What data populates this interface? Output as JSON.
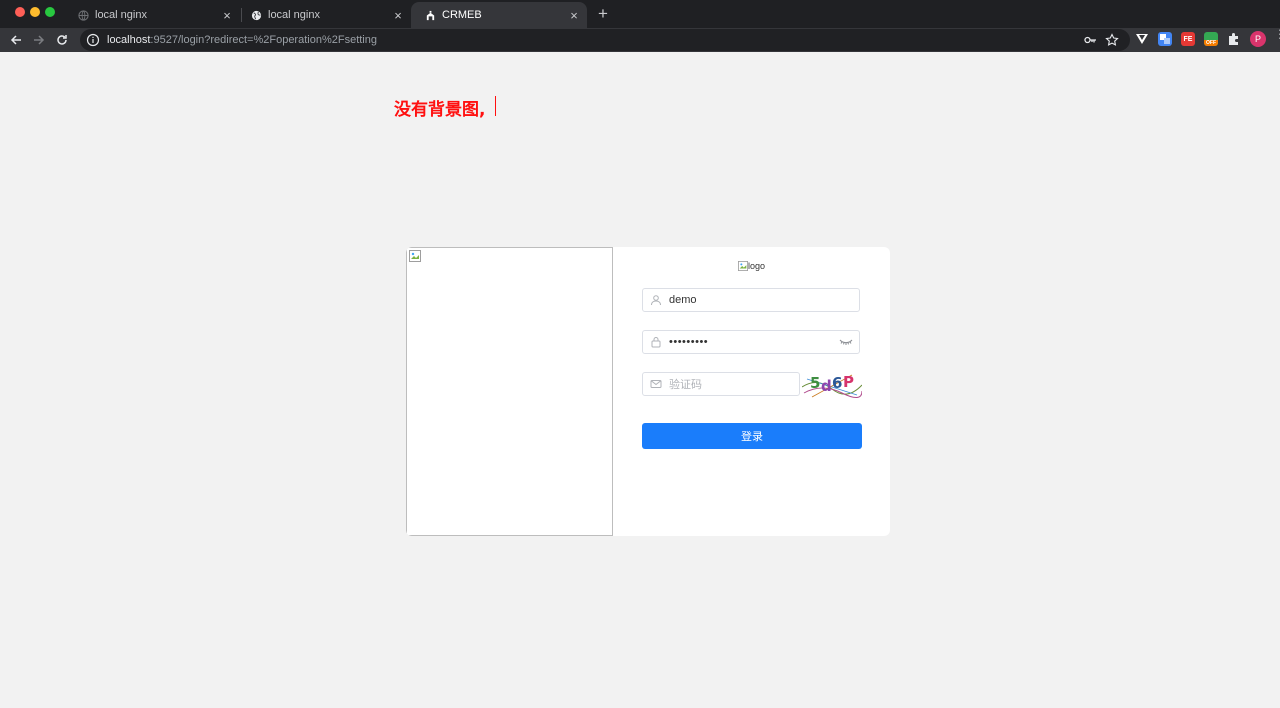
{
  "browser": {
    "tabs": [
      {
        "title": "local nginx",
        "active": false
      },
      {
        "title": "local nginx",
        "active": false
      },
      {
        "title": "CRMEB",
        "active": true
      }
    ],
    "url_host": "localhost",
    "url_rest": ":9527/login?redirect=%2Foperation%2Fsetting",
    "close_glyph": "×",
    "new_tab_glyph": "+",
    "extensions": [
      {
        "name": "vue-devtools-icon",
        "color": "#4fc08d"
      },
      {
        "name": "translate-icon",
        "color": "#4285f4"
      },
      {
        "name": "fe-helper-icon",
        "color": "#e53935",
        "label": "FE"
      },
      {
        "name": "off-badge-icon",
        "color": "#34a853",
        "label": "OFF"
      }
    ],
    "avatar_letter": "P"
  },
  "page": {
    "note": "没有背景图,",
    "logo_alt": "logo",
    "username_value": "demo",
    "password_masked": "•••••••••",
    "captcha_placeholder": "验证码",
    "captcha_text": "5d6P",
    "login_label": "登录",
    "colors": {
      "primary": "#1a7dfb",
      "note": "#ff1010",
      "background": "#f2f2f2"
    }
  }
}
